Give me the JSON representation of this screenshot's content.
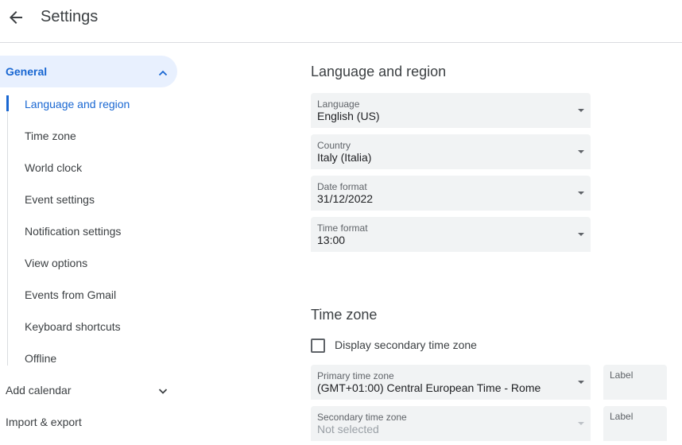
{
  "header": {
    "title": "Settings",
    "back_icon": "arrow-back-icon"
  },
  "sidebar": {
    "general": {
      "label": "General",
      "expanded": true
    },
    "sub_items": [
      {
        "label": "Language and region",
        "active": true
      },
      {
        "label": "Time zone"
      },
      {
        "label": "World clock"
      },
      {
        "label": "Event settings"
      },
      {
        "label": "Notification settings"
      },
      {
        "label": "View options"
      },
      {
        "label": "Events from Gmail"
      },
      {
        "label": "Keyboard shortcuts"
      },
      {
        "label": "Offline"
      }
    ],
    "add_calendar": {
      "label": "Add calendar",
      "expanded": false
    },
    "import_export": {
      "label": "Import & export"
    }
  },
  "language_region": {
    "title": "Language and region",
    "fields": [
      {
        "label": "Language",
        "value": "English (US)"
      },
      {
        "label": "Country",
        "value": "Italy (Italia)"
      },
      {
        "label": "Date format",
        "value": "31/12/2022"
      },
      {
        "label": "Time format",
        "value": "13:00"
      }
    ]
  },
  "time_zone": {
    "title": "Time zone",
    "secondary_checkbox_label": "Display secondary time zone",
    "secondary_checked": false,
    "primary": {
      "label": "Primary time zone",
      "value": "(GMT+01:00) Central European Time - Rome",
      "label_field": "Label"
    },
    "secondary": {
      "label": "Secondary time zone",
      "value": "Not selected",
      "label_field": "Label",
      "disabled": true
    }
  },
  "colors": {
    "accent": "#1967d2",
    "accent_bg": "#e8f0fe",
    "field_bg": "#f1f3f4",
    "text": "#3c4043"
  }
}
